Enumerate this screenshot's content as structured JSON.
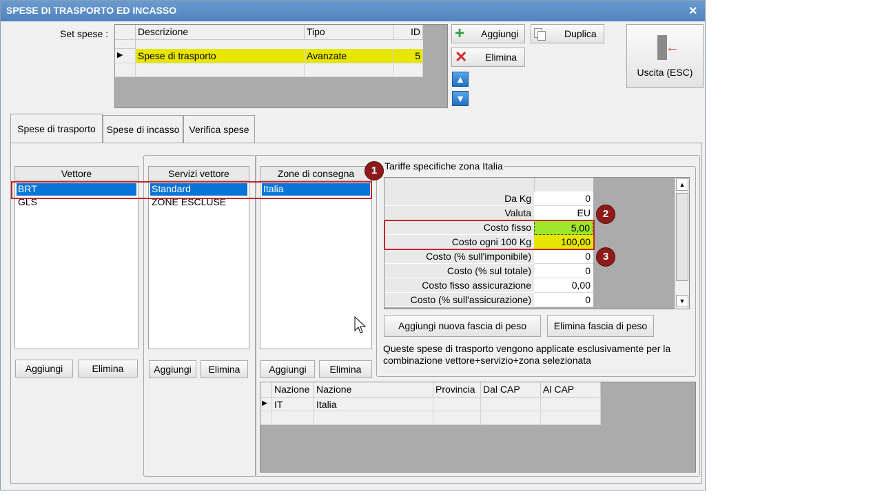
{
  "window": {
    "title": "SPESE DI TRASPORTO ED INCASSO",
    "close_glyph": "✕"
  },
  "set_spese": {
    "label": "Set spese :",
    "columns": [
      "Descrizione",
      "Tipo",
      "ID"
    ],
    "rows": [
      {
        "descrizione": "Spese di trasporto",
        "tipo": "Avanzate",
        "id": "5"
      }
    ]
  },
  "toolbar": {
    "aggiungi": "Aggiungi",
    "duplica": "Duplica",
    "elimina": "Elimina",
    "uscita": "Uscita (ESC)"
  },
  "tabs": [
    "Spese di trasporto",
    "Spese di incasso",
    "Verifica spese"
  ],
  "vettore": {
    "header": "Vettore",
    "items": [
      "BRT",
      "GLS"
    ],
    "aggiungi": "Aggiungi",
    "elimina": "Elimina"
  },
  "servizi": {
    "header": "Servizi vettore",
    "items": [
      "Standard",
      "ZONE ESCLUSE"
    ],
    "aggiungi": "Aggiungi",
    "elimina": "Elimina"
  },
  "zone": {
    "header": "Zone di consegna",
    "items": [
      "Italia"
    ],
    "aggiungi": "Aggiungi",
    "elimina": "Elimina"
  },
  "tariffe": {
    "title": "Tariffe specifiche zona Italia",
    "rows": [
      {
        "label": "Da Kg",
        "value": "0"
      },
      {
        "label": "Valuta",
        "value": "EU"
      },
      {
        "label": "Costo fisso",
        "value": "5,00"
      },
      {
        "label": "Costo ogni 100 Kg",
        "value": "100,00"
      },
      {
        "label": "Costo (% sull'imponibile)",
        "value": "0"
      },
      {
        "label": "Costo (% sul totale)",
        "value": "0"
      },
      {
        "label": "Costo fisso assicurazione",
        "value": "0,00"
      },
      {
        "label": "Costo (% sull'assicurazione)",
        "value": "0"
      }
    ],
    "add_button": "Aggiungi nuova fascia di peso",
    "remove_button": "Elimina fascia di peso",
    "note": "Queste spese di trasporto vengono applicate esclusivamente per la combinazione vettore+servizio+zona selezionata"
  },
  "nazioni": {
    "columns": [
      "Nazione",
      "Nazione",
      "Provincia",
      "Dal CAP",
      "Al CAP"
    ],
    "rows": [
      {
        "code": "IT",
        "name": "Italia",
        "provincia": "",
        "dal": "",
        "al": ""
      }
    ]
  },
  "badges": [
    "1",
    "2",
    "3"
  ],
  "colors": {
    "highlight_yellow": "#e6e600",
    "highlight_green": "#9ee62b",
    "selection_blue": "#0a74d6",
    "annotation_red": "#c0262c"
  }
}
